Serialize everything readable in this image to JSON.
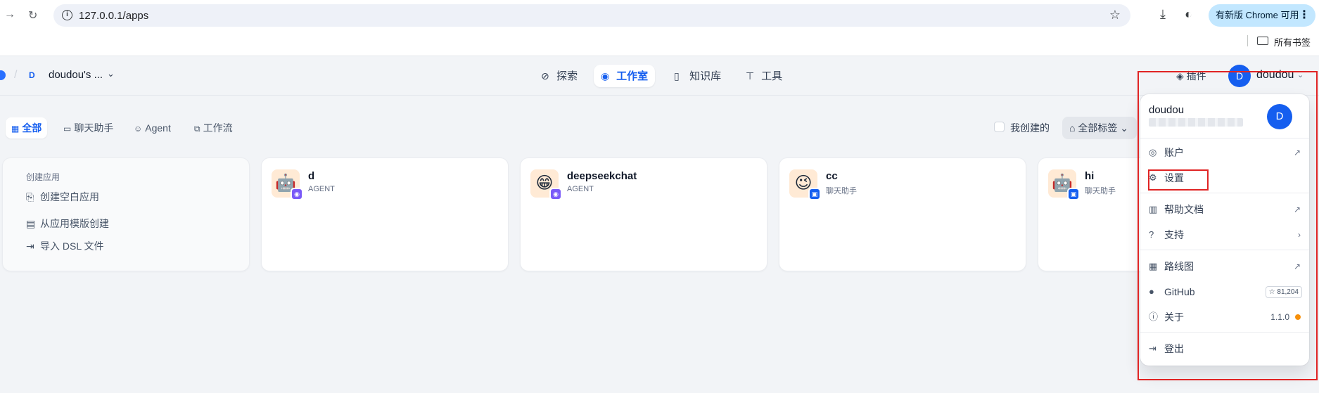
{
  "browser": {
    "url": "127.0.0.1/apps",
    "update_label": "有新版 Chrome 可用",
    "bookmarks_label": "所有书签"
  },
  "header": {
    "workspace_badge": "D",
    "workspace_name": "doudou's ...",
    "nav": [
      {
        "label": "探索",
        "icon": "compass-icon"
      },
      {
        "label": "工作室",
        "icon": "robot-icon",
        "active": true
      },
      {
        "label": "知识库",
        "icon": "book-icon"
      },
      {
        "label": "工具",
        "icon": "hammer-icon"
      }
    ],
    "plugins_label": "插件",
    "user_initial": "D",
    "user_name": "doudou"
  },
  "filters": {
    "tabs": [
      {
        "label": "全部",
        "active": true
      },
      {
        "label": "聊天助手"
      },
      {
        "label": "Agent"
      },
      {
        "label": "工作流"
      }
    ],
    "mine_label": "我创建的",
    "tags_label": "全部标签"
  },
  "create_card": {
    "title": "创建应用",
    "actions": [
      "创建空白应用",
      "从应用模版创建",
      "导入 DSL 文件"
    ]
  },
  "apps": [
    {
      "name": "d",
      "type": "AGENT",
      "emoji": "🤖",
      "badge": "agent"
    },
    {
      "name": "deepseekchat",
      "type": "AGENT",
      "emoji": "😁",
      "badge": "agent"
    },
    {
      "name": "cc",
      "type": "聊天助手",
      "emoji": "😉",
      "badge": "chat"
    },
    {
      "name": "hi",
      "type": "聊天助手",
      "emoji": "🤖",
      "badge": "chat"
    }
  ],
  "menu": {
    "user_name": "doudou",
    "avatar_initial": "D",
    "items": {
      "account": "账户",
      "settings": "设置",
      "help": "帮助文档",
      "support": "支持",
      "roadmap": "路线图",
      "github": "GitHub",
      "github_stars": "81,204",
      "about": "关于",
      "version": "1.1.0",
      "logout": "登出"
    }
  },
  "colors": {
    "accent": "#155eef",
    "annotation": "#e02424",
    "update_dot": "#f79009"
  }
}
